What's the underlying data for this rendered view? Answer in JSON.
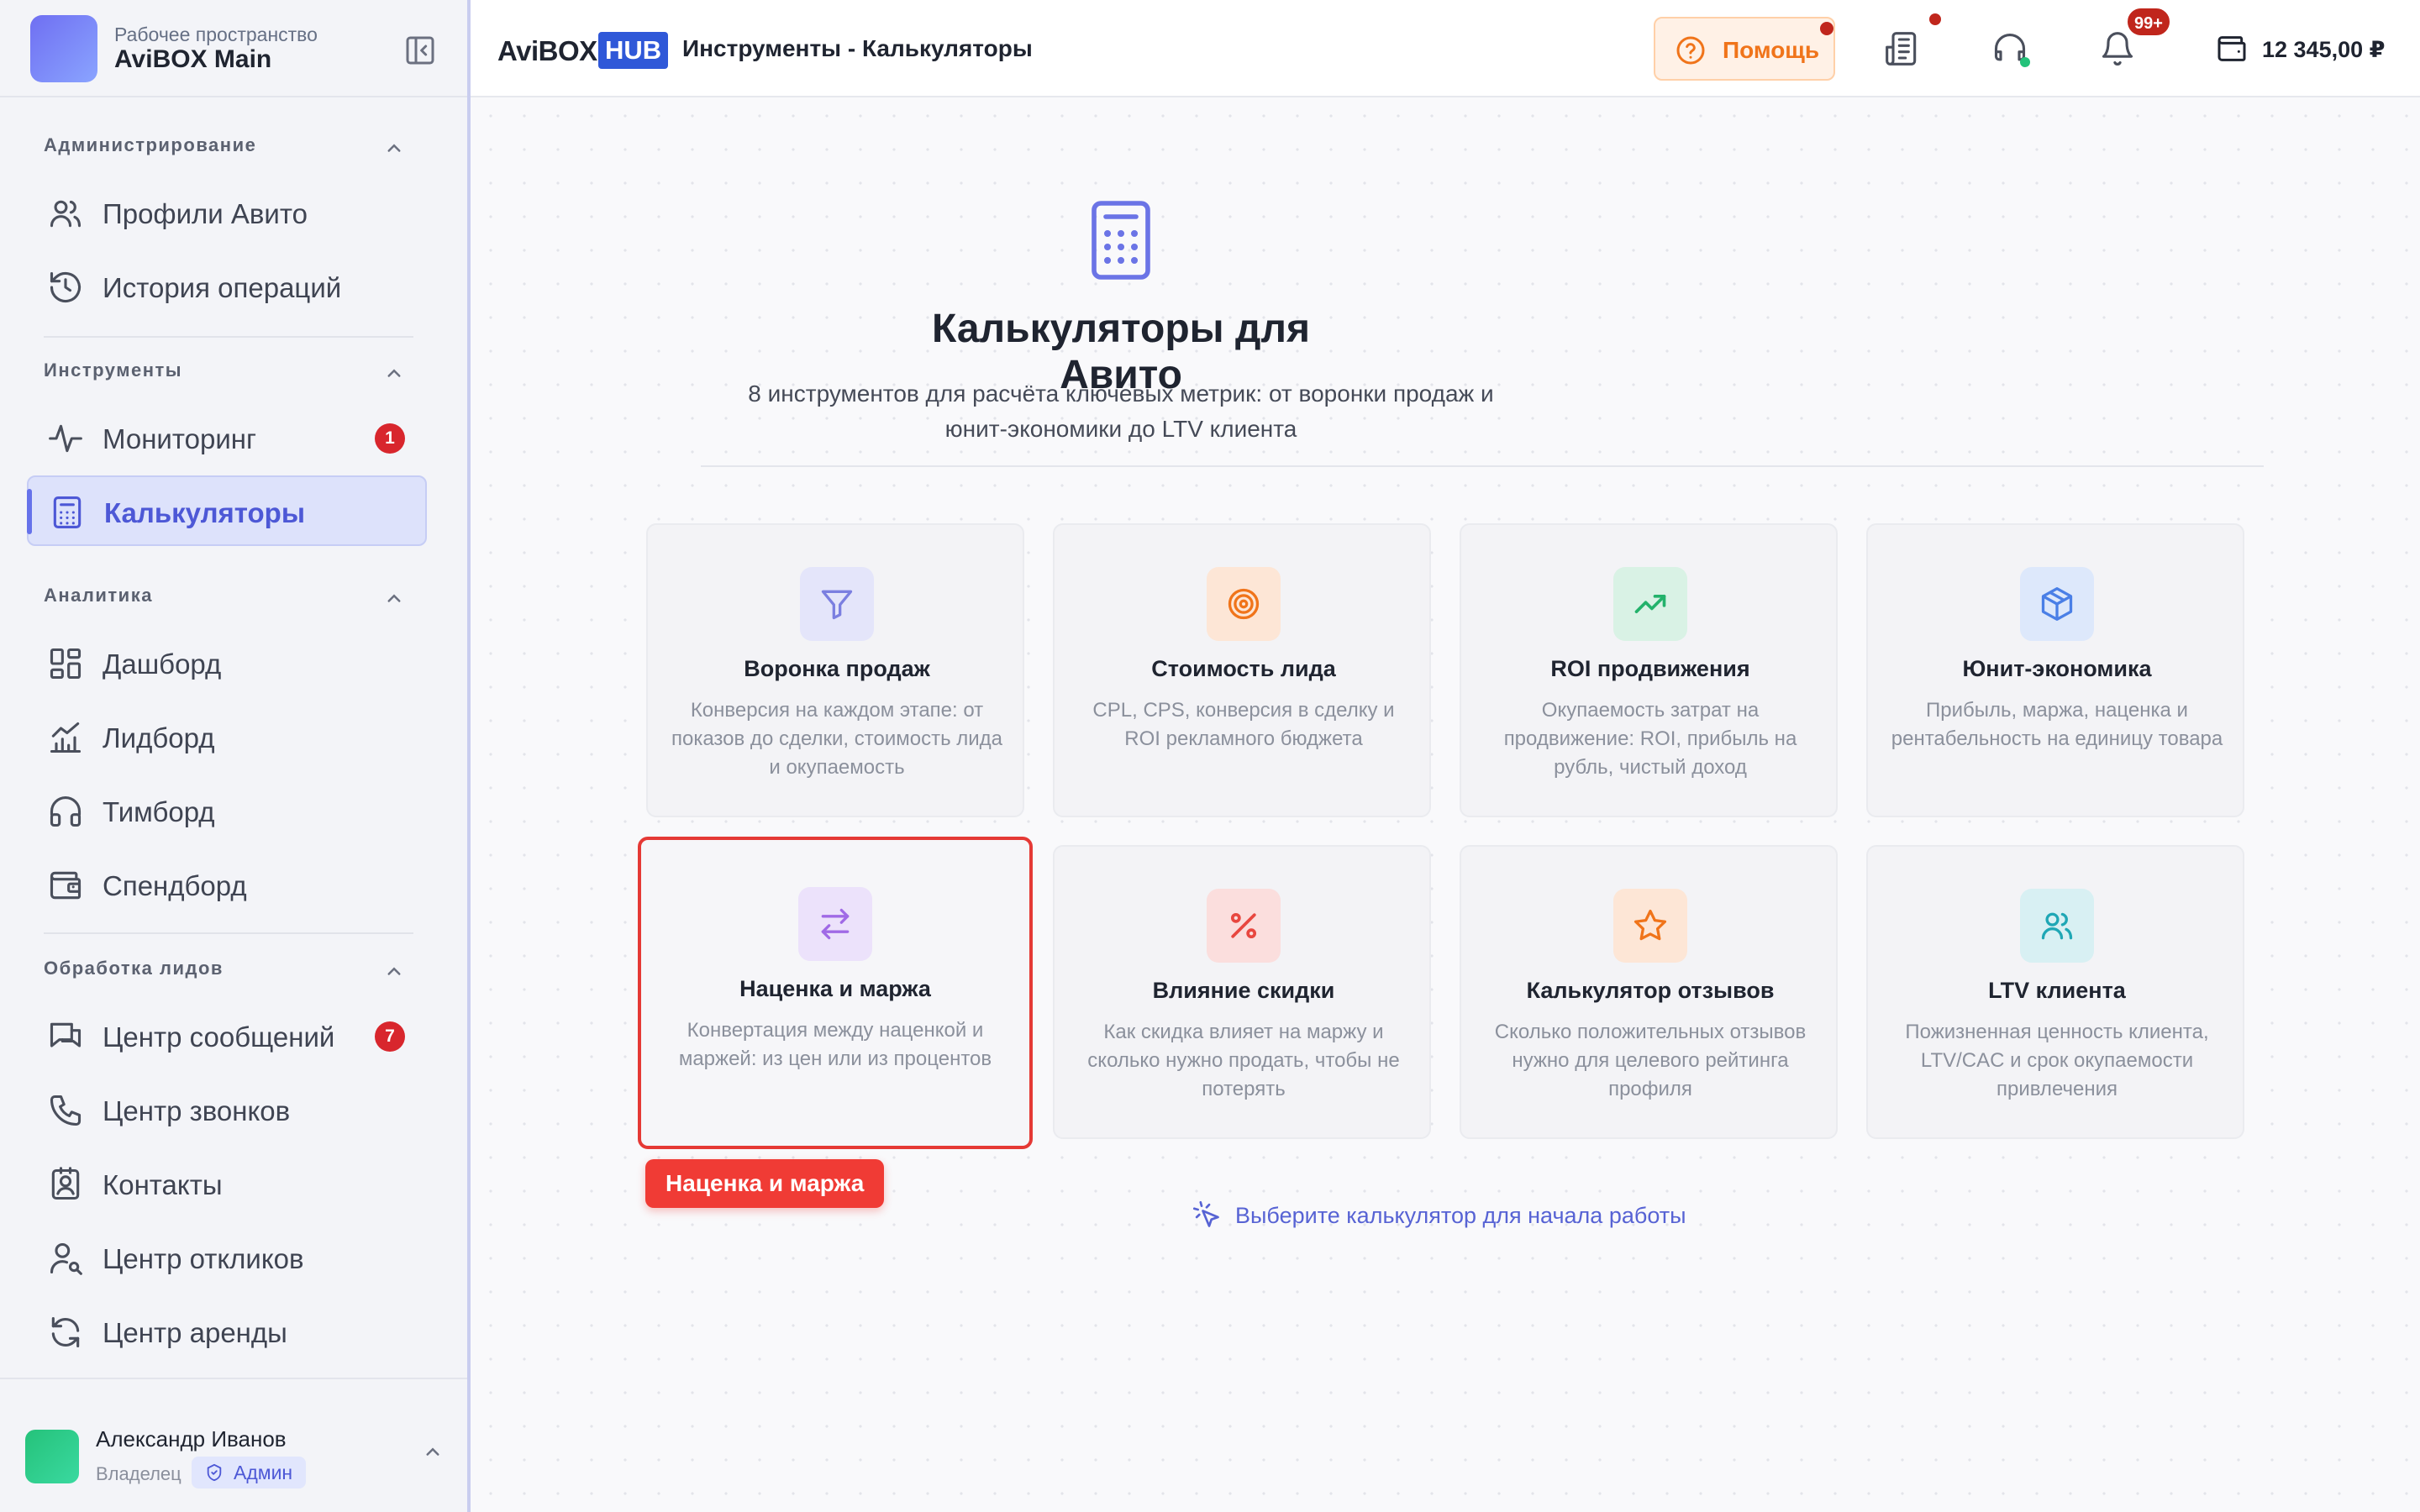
{
  "workspace": {
    "subtitle": "Рабочее пространство",
    "name": "AviBOX Main"
  },
  "sidebar": {
    "sections": [
      {
        "title": "Администрирование"
      },
      {
        "title": "Инструменты"
      },
      {
        "title": "Аналитика"
      },
      {
        "title": "Обработка лидов"
      }
    ],
    "items": [
      {
        "label": "Профили Авито",
        "icon": "users-icon"
      },
      {
        "label": "История операций",
        "icon": "history-icon"
      },
      {
        "label": "Мониторинг",
        "icon": "activity-icon",
        "count": "1"
      },
      {
        "label": "Калькуляторы",
        "icon": "calculator-icon",
        "active": true
      },
      {
        "label": "Дашборд",
        "icon": "dashboard-icon"
      },
      {
        "label": "Лидборд",
        "icon": "chart-icon"
      },
      {
        "label": "Тимборд",
        "icon": "headphones-icon"
      },
      {
        "label": "Спендборд",
        "icon": "wallet-icon"
      },
      {
        "label": "Центр сообщений",
        "icon": "messages-icon",
        "count": "7"
      },
      {
        "label": "Центр звонков",
        "icon": "phone-icon"
      },
      {
        "label": "Контакты",
        "icon": "contacts-icon"
      },
      {
        "label": "Центр откликов",
        "icon": "user-search-icon"
      },
      {
        "label": "Центр аренды",
        "icon": "refresh-icon"
      }
    ]
  },
  "user": {
    "name": "Александр Иванов",
    "role": "Владелец",
    "badge": "Админ"
  },
  "header": {
    "brand_a": "AviBOX",
    "brand_b": "HUB",
    "title": "Инструменты - Калькуляторы",
    "help_label": "Помощь",
    "notifications_badge": "99+",
    "balance": "12 345,00 ₽"
  },
  "hero": {
    "title": "Калькуляторы для Авито",
    "subtitle_line1": "8 инструментов для расчёта ключевых метрик: от воронки продаж и",
    "subtitle_line2": "юнит-экономики до LTV клиента"
  },
  "cards": [
    {
      "title": "Воронка продаж",
      "desc": "Конверсия на каждом этапе: от показов до сделки, стоимость лида и окупаемость",
      "icon": "funnel-icon",
      "color": "#7b7fe0",
      "bg": "#e4e5fa"
    },
    {
      "title": "Стоимость лида",
      "desc": "CPL, CPS, конверсия в сделку и ROI рекламного бюджета",
      "icon": "target-icon",
      "color": "#f0741a",
      "bg": "#fde6d6"
    },
    {
      "title": "ROI продвижения",
      "desc": "Окупаемость затрат на продвижение: ROI, прибыль на рубль, чистый доход",
      "icon": "trending-up-icon",
      "color": "#23b26b",
      "bg": "#d9f2e5"
    },
    {
      "title": "Юнит-экономика",
      "desc": "Прибыль, маржа, наценка и рентабельность на единицу товара",
      "icon": "box-icon",
      "color": "#4a7fe6",
      "bg": "#dde8fb"
    },
    {
      "title": "Наценка и маржа",
      "desc": "Конвертация между наценкой и маржей: из цен или из процентов",
      "icon": "arrows-exchange-icon",
      "color": "#a06ae6",
      "bg": "#ece2fb",
      "highlighted": true
    },
    {
      "title": "Влияние скидки",
      "desc": "Как скидка влияет на маржу и сколько нужно продать, чтобы не потерять",
      "icon": "percent-icon",
      "color": "#e8473f",
      "bg": "#fbdedd"
    },
    {
      "title": "Калькулятор отзывов",
      "desc": "Сколько положительных отзывов нужно для целевого рейтинга профиля",
      "icon": "star-icon",
      "color": "#f0741a",
      "bg": "#fde6d6"
    },
    {
      "title": "LTV клиента",
      "desc": "Пожизненная ценность клиента, LTV/CAC и срок окупаемости привлечения",
      "icon": "users-icon",
      "color": "#1fa7b5",
      "bg": "#d8f0f3"
    }
  ],
  "highlight_tag": "Наценка и маржа",
  "hint": "Выберите калькулятор для начала работы"
}
